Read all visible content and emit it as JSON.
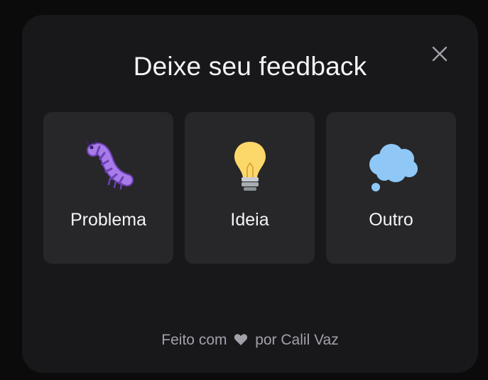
{
  "widget": {
    "title": "Deixe seu feedback",
    "close_icon": "close-icon",
    "options": [
      {
        "label": "Problema",
        "icon": "bug-caterpillar-icon"
      },
      {
        "label": "Ideia",
        "icon": "lightbulb-icon"
      },
      {
        "label": "Outro",
        "icon": "thought-balloon-icon"
      }
    ],
    "footer": {
      "prefix": "Feito com",
      "heart_icon": "heart-icon",
      "suffix": "por",
      "author": "Calil Vaz"
    }
  },
  "colors": {
    "page_bg": "#0b0b0c",
    "widget_bg": "#18181b",
    "card_bg": "#27272a",
    "text": "#f4f4f5",
    "muted": "#a1a1aa"
  }
}
